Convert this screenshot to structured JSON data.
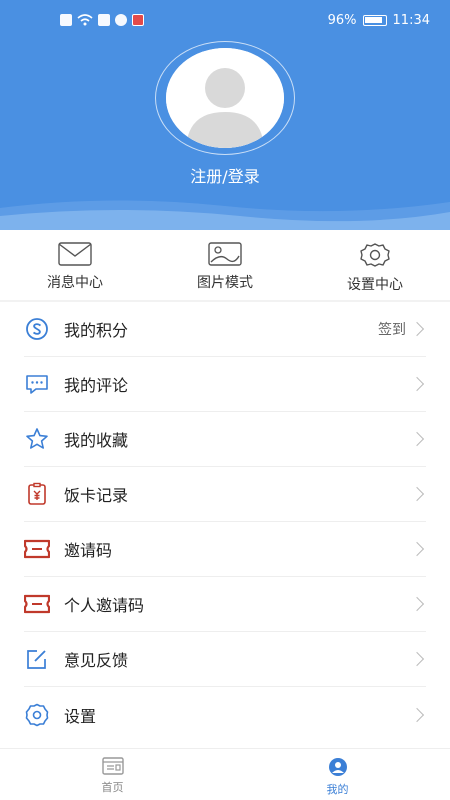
{
  "status_bar": {
    "battery": "96%",
    "time": "11:34"
  },
  "profile": {
    "login_text": "注册/登录"
  },
  "quick_actions": [
    {
      "label": "消息中心",
      "icon": "envelope-icon"
    },
    {
      "label": "图片模式",
      "icon": "image-icon"
    },
    {
      "label": "设置中心",
      "icon": "gear-icon"
    }
  ],
  "menu": [
    {
      "label": "我的积分",
      "icon": "points-icon",
      "right_text": "签到"
    },
    {
      "label": "我的评论",
      "icon": "comment-icon",
      "right_text": ""
    },
    {
      "label": "我的收藏",
      "icon": "star-icon",
      "right_text": ""
    },
    {
      "label": "饭卡记录",
      "icon": "meal-card-icon",
      "right_text": ""
    },
    {
      "label": "邀请码",
      "icon": "ticket-icon",
      "right_text": ""
    },
    {
      "label": "个人邀请码",
      "icon": "ticket-icon",
      "right_text": ""
    },
    {
      "label": "意见反馈",
      "icon": "feedback-icon",
      "right_text": ""
    },
    {
      "label": "设置",
      "icon": "gear-icon",
      "right_text": ""
    }
  ],
  "bottom_nav": [
    {
      "label": "首页",
      "icon": "home-icon",
      "active": false
    },
    {
      "label": "我的",
      "icon": "profile-icon",
      "active": true
    }
  ],
  "colors": {
    "header": "#4a90e2",
    "accent_blue": "#3b7fd6",
    "accent_red": "#c0392b"
  }
}
